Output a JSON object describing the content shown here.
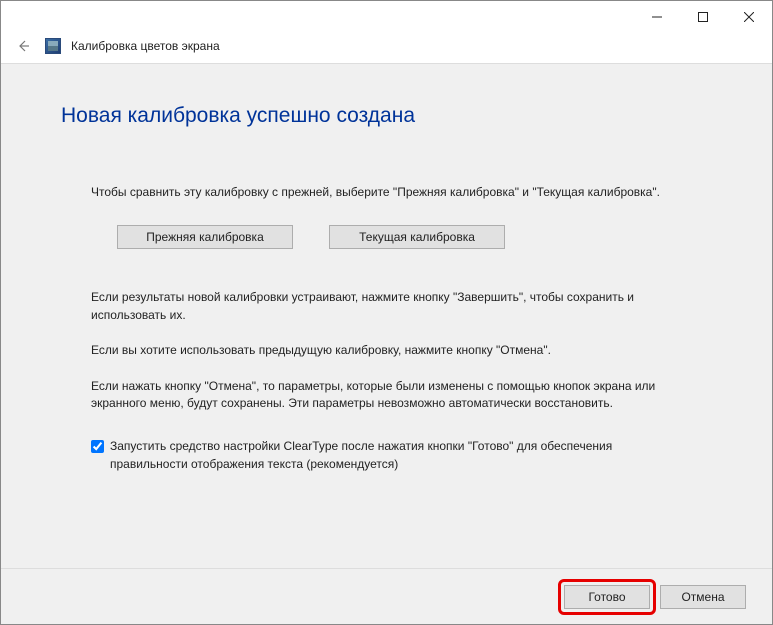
{
  "titlebar": {
    "minimize": "—",
    "maximize": "☐",
    "close": "✕"
  },
  "header": {
    "app_title": "Калибровка цветов экрана"
  },
  "content": {
    "heading": "Новая калибровка успешно создана",
    "compare_intro": "Чтобы сравнить эту калибровку с прежней, выберите \"Прежняя калибровка\" и \"Текущая калибровка\".",
    "btn_previous": "Прежняя калибровка",
    "btn_current": "Текущая калибровка",
    "para_finish": "Если результаты новой калибровки устраивают, нажмите кнопку \"Завершить\", чтобы сохранить и использовать их.",
    "para_cancel": "Если вы хотите использовать предыдущую калибровку, нажмите кнопку \"Отмена\".",
    "para_note": "Если нажать кнопку \"Отмена\", то параметры, которые были изменены с помощью кнопок экрана или экранного меню, будут сохранены. Эти параметры невозможно автоматически восстановить.",
    "checkbox_label": "Запустить средство настройки ClearType после нажатия кнопки \"Готово\" для обеспечения правильности отображения текста (рекомендуется)",
    "checkbox_checked": true
  },
  "footer": {
    "done": "Готово",
    "cancel": "Отмена"
  }
}
